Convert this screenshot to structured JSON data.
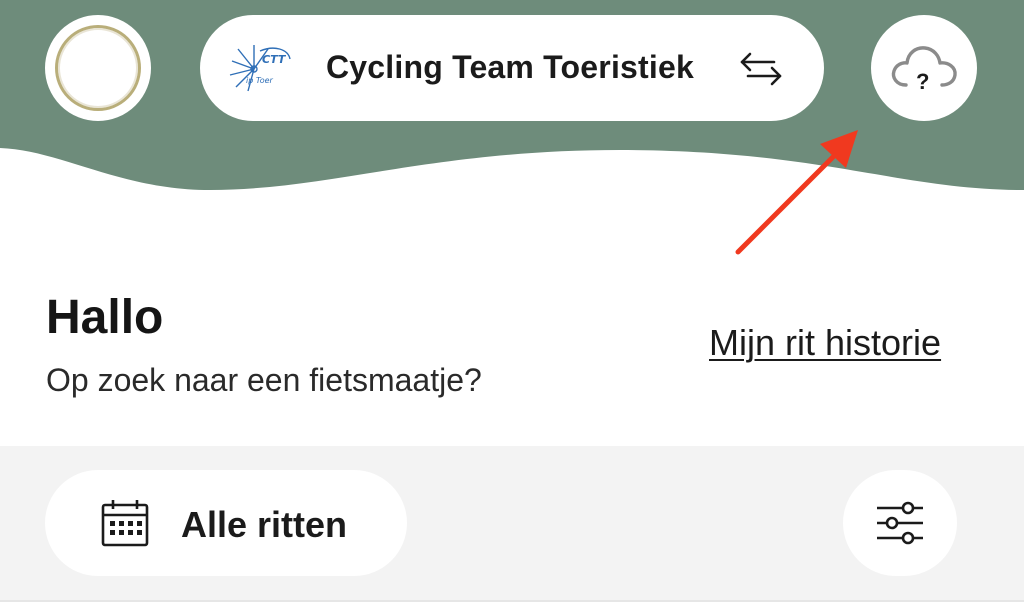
{
  "header": {
    "team_name": "Cycling Team Toeristiek",
    "logo_text": "CTT",
    "logo_subtext": "ip Toer",
    "background_color": "#6e8c7b",
    "icons": {
      "avatar": "avatar",
      "swap": "swap-arrows-icon",
      "weather": "cloud-question-icon"
    }
  },
  "annotation": {
    "arrow_color": "#f0391f"
  },
  "greeting": {
    "title": "Hallo",
    "subtitle": "Op zoek naar een fietsmaatje?"
  },
  "history_link": "Mijn rit historie",
  "filters": {
    "rides_label": "Alle ritten",
    "icons": {
      "calendar": "calendar-icon",
      "filter": "sliders-icon"
    }
  }
}
